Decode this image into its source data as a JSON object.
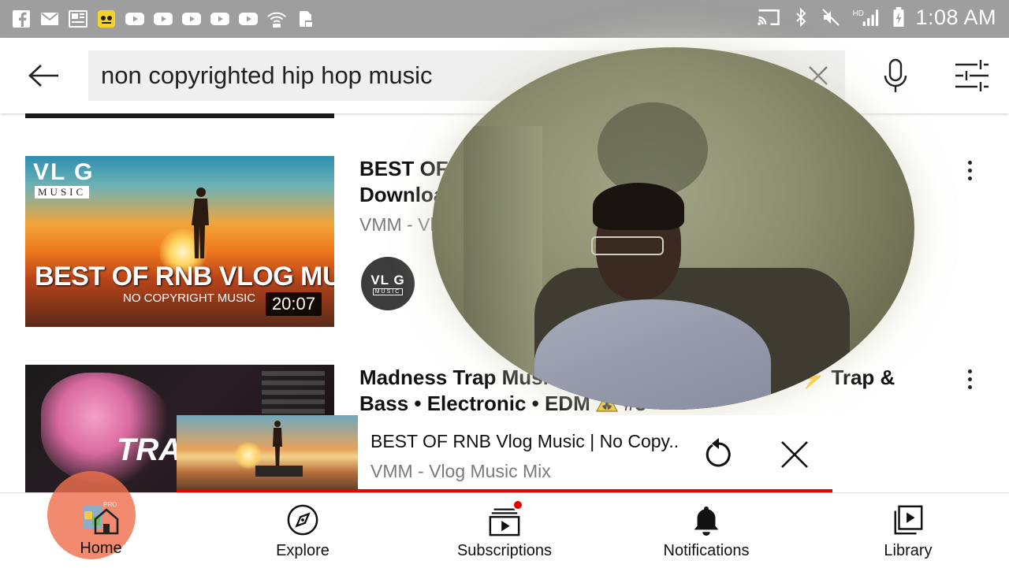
{
  "status_bar": {
    "time": "1:08 AM",
    "left_icons": [
      "facebook-icon",
      "gmail-icon",
      "news-icon",
      "emoji-app-icon",
      "youtube-icon",
      "youtube-icon",
      "youtube-icon",
      "youtube-icon",
      "youtube-icon",
      "wifi-lock-icon",
      "sd-card-lock-icon"
    ],
    "right_icons": [
      "cast-icon",
      "bluetooth-icon",
      "mute-icon",
      "hd-signal-icon",
      "battery-charging-icon"
    ]
  },
  "search": {
    "query": "non copyrighted hip hop music"
  },
  "videos": [
    {
      "title": "BEST OF R\nDownloac",
      "channel": "VMM - Vlo",
      "duration": "20:07",
      "thumb_brand": "VL  G",
      "thumb_brand_sub": "MUSIC",
      "thumb_title": "BEST OF RNB VLOG MUSIC",
      "thumb_subtitle": "NO COPYRIGHT MUSIC",
      "avatar_top": "VL G",
      "avatar_bottom": "MUSIC"
    },
    {
      "title": "Madness Trap Music",
      "title_tail": "Trap &",
      "title_line2": "Bass • Electronic  • EDM",
      "title_suffix": "#3",
      "thumb_text": "TRAP"
    }
  ],
  "miniplayer": {
    "title": "BEST OF RNB Vlog Music | No Copy..",
    "channel": "VMM - Vlog Music Mix",
    "progress": 1.0,
    "progress_color": "#e60000"
  },
  "bottom_nav": {
    "home": "Home",
    "explore": "Explore",
    "subscriptions": "Subscriptions",
    "notifications": "Notifications",
    "library": "Library"
  },
  "colors": {
    "status_bar": "#9e9e9e",
    "accent_red": "#e60000",
    "home_highlight": "#ee704e"
  }
}
